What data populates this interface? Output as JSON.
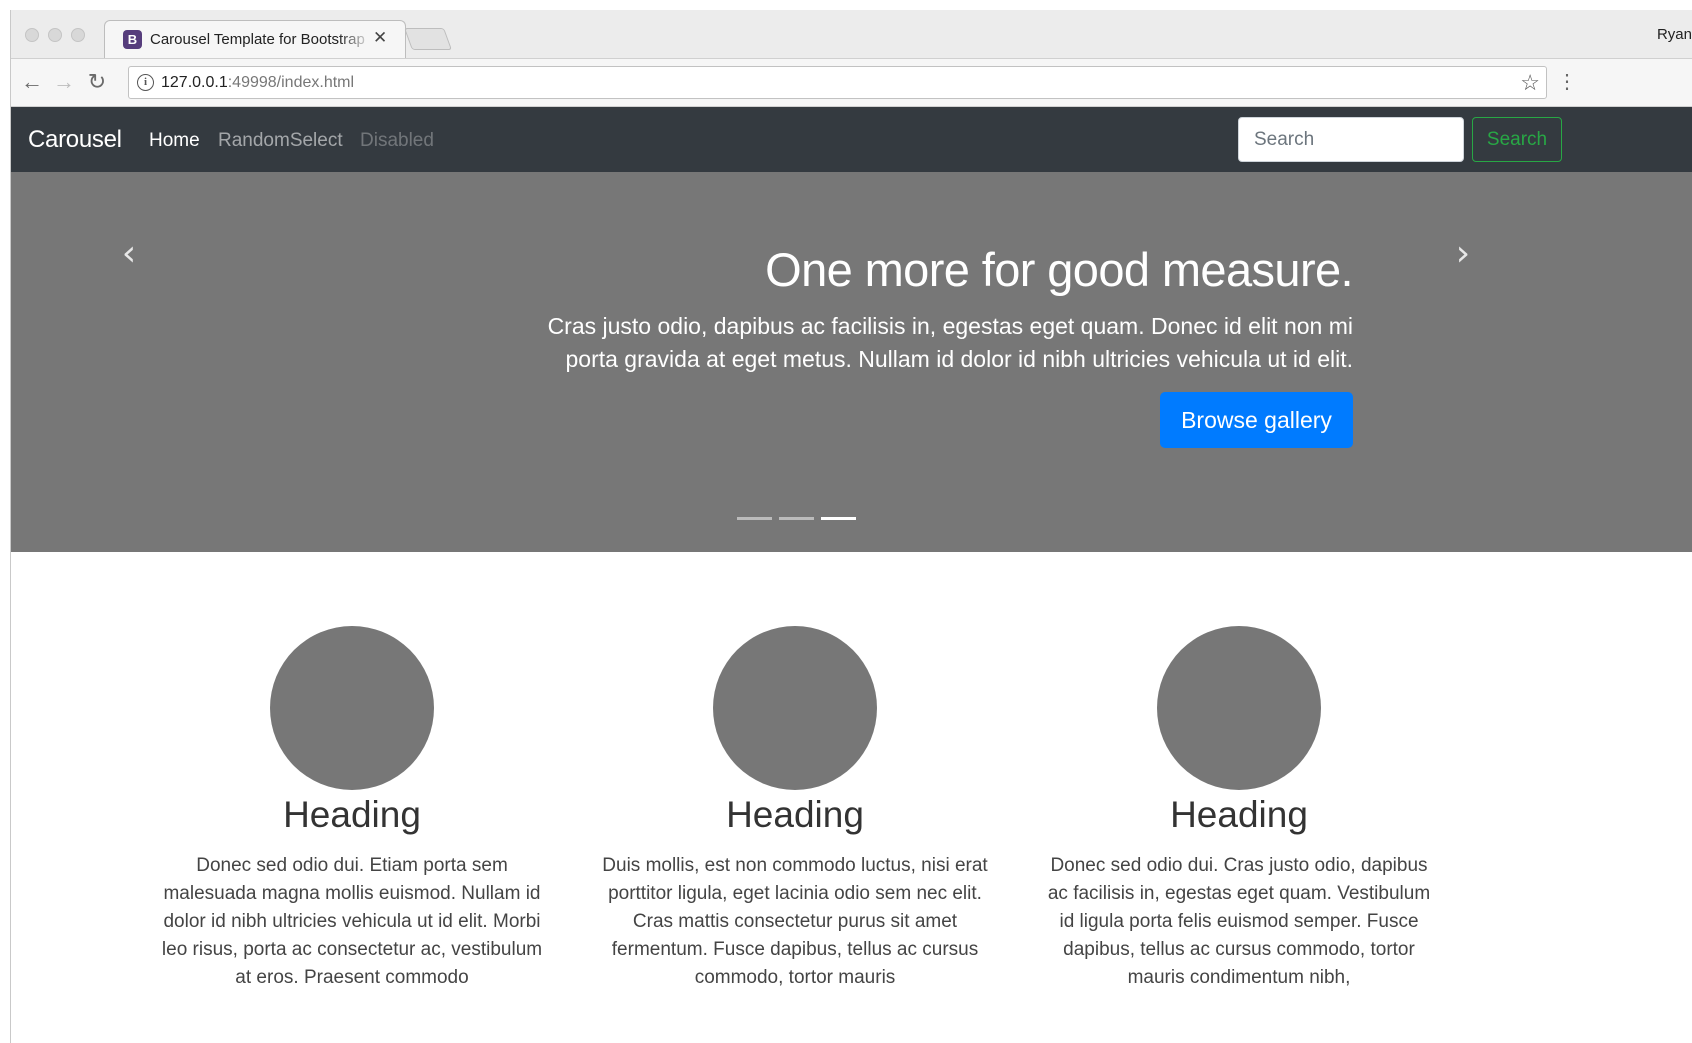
{
  "browser": {
    "tab_title": "Carousel Template for Bootstrap",
    "tab_favicon": "B",
    "close_glyph": "✕",
    "profile_name": "Ryan",
    "url_host": "127.0.0.1",
    "url_rest": ":49998/index.html",
    "info_glyph": "i",
    "star_glyph": "☆",
    "menu_glyph": "⋮",
    "back_glyph": "←",
    "forward_glyph": "→",
    "reload_glyph": "↻"
  },
  "navbar": {
    "brand": "Carousel",
    "links": {
      "home": "Home",
      "random": "RandomSelect",
      "disabled": "Disabled"
    },
    "search_placeholder": "Search",
    "search_button": "Search"
  },
  "carousel": {
    "heading": "One more for good measure.",
    "text": "Cras justo odio, dapibus ac facilisis in, egestas eget quam. Donec id elit non mi porta gravida at eget metus. Nullam id dolor id nibh ultricies vehicula ut id elit.",
    "button": "Browse gallery",
    "prev_glyph": "‹",
    "next_glyph": "›",
    "active_slide": 3,
    "slide_count": 3
  },
  "columns": [
    {
      "heading": "Heading",
      "text": "Donec sed odio dui. Etiam porta sem malesuada magna mollis euismod. Nullam id dolor id nibh ultricies vehicula ut id elit. Morbi leo risus, porta ac consectetur ac, vestibulum at eros. Praesent commodo"
    },
    {
      "heading": "Heading",
      "text": "Duis mollis, est non commodo luctus, nisi erat porttitor ligula, eget lacinia odio sem nec elit. Cras mattis consectetur purus sit amet fermentum. Fusce dapibus, tellus ac cursus commodo, tortor mauris"
    },
    {
      "heading": "Heading",
      "text": "Donec sed odio dui. Cras justo odio, dapibus ac facilisis in, egestas eget quam. Vestibulum id ligula porta felis euismod semper. Fusce dapibus, tellus ac cursus commodo, tortor mauris condimentum nibh,"
    }
  ],
  "colors": {
    "navbar_bg": "#343a40",
    "carousel_bg": "#777777",
    "primary": "#007bff",
    "success": "#28a745"
  }
}
